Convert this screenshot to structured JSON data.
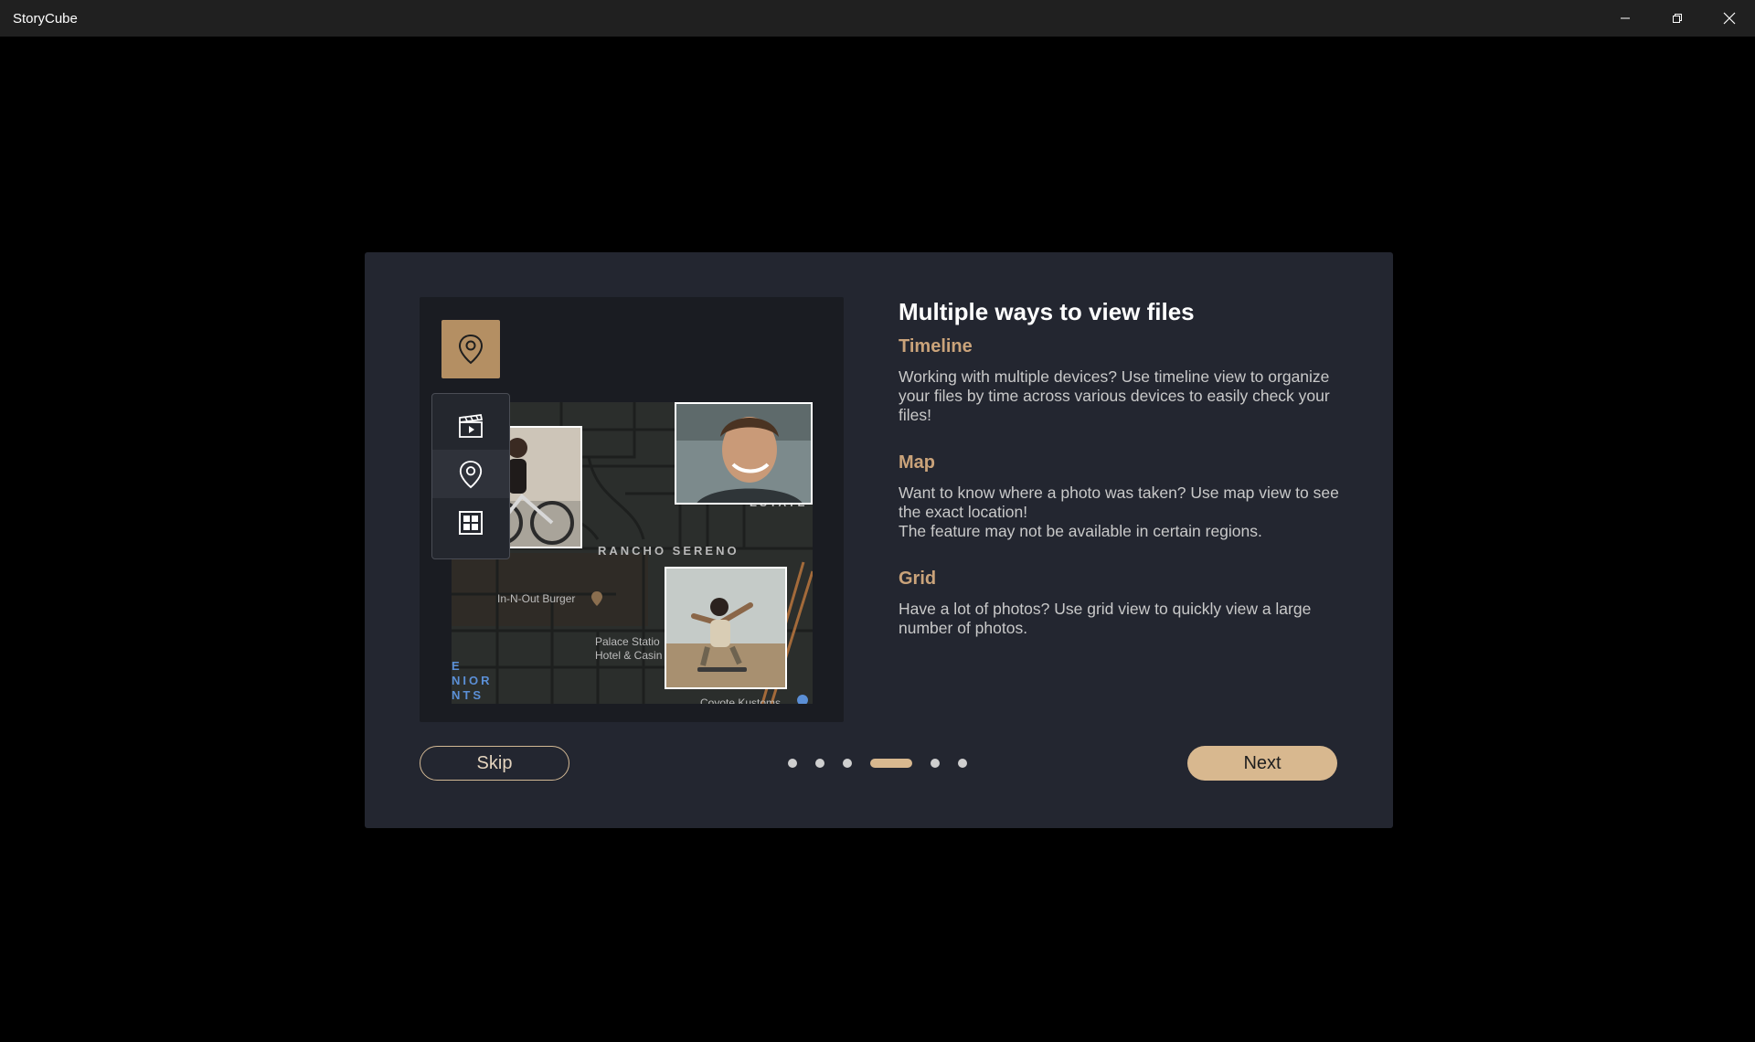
{
  "window": {
    "title": "StoryCube",
    "minimize_icon": "minimize-icon",
    "restore_icon": "restore-icon",
    "close_icon": "close-icon"
  },
  "preview": {
    "location_tile_icon": "map-pin-icon",
    "view_options": [
      {
        "icon": "video-clapper-icon"
      },
      {
        "icon": "map-pin-icon"
      },
      {
        "icon": "grid-icon"
      }
    ],
    "map_labels": {
      "neighborhood": "RANCHO SERENO",
      "estate": "ESTATE",
      "poi1": "In-N-Out Burger",
      "poi2_line1": "Palace Statio",
      "poi2_line2": "Hotel & Casin",
      "blue_line1": "E",
      "blue_line2": "NIOR",
      "blue_line3": "NTS",
      "bottom": "Coyote Kustoms"
    }
  },
  "content": {
    "heading": "Multiple ways to view files",
    "sections": [
      {
        "title": "Timeline",
        "text": "Working with multiple devices? Use timeline view to organize your files by time across various devices to easily check your files!"
      },
      {
        "title": "Map",
        "text_line1": "Want to know where a photo was taken? Use map view to see the exact location!",
        "text_line2": "The feature may not be available in certain regions."
      },
      {
        "title": "Grid",
        "text": "Have a lot of photos? Use grid view to quickly view a large number of photos."
      }
    ]
  },
  "footer": {
    "skip_label": "Skip",
    "next_label": "Next",
    "page_count": 6,
    "current_page": 4
  },
  "colors": {
    "accent": "#d8b88f",
    "section_title": "#caa37a",
    "dialog_bg": "#232630",
    "titlebar_bg": "#202020"
  }
}
